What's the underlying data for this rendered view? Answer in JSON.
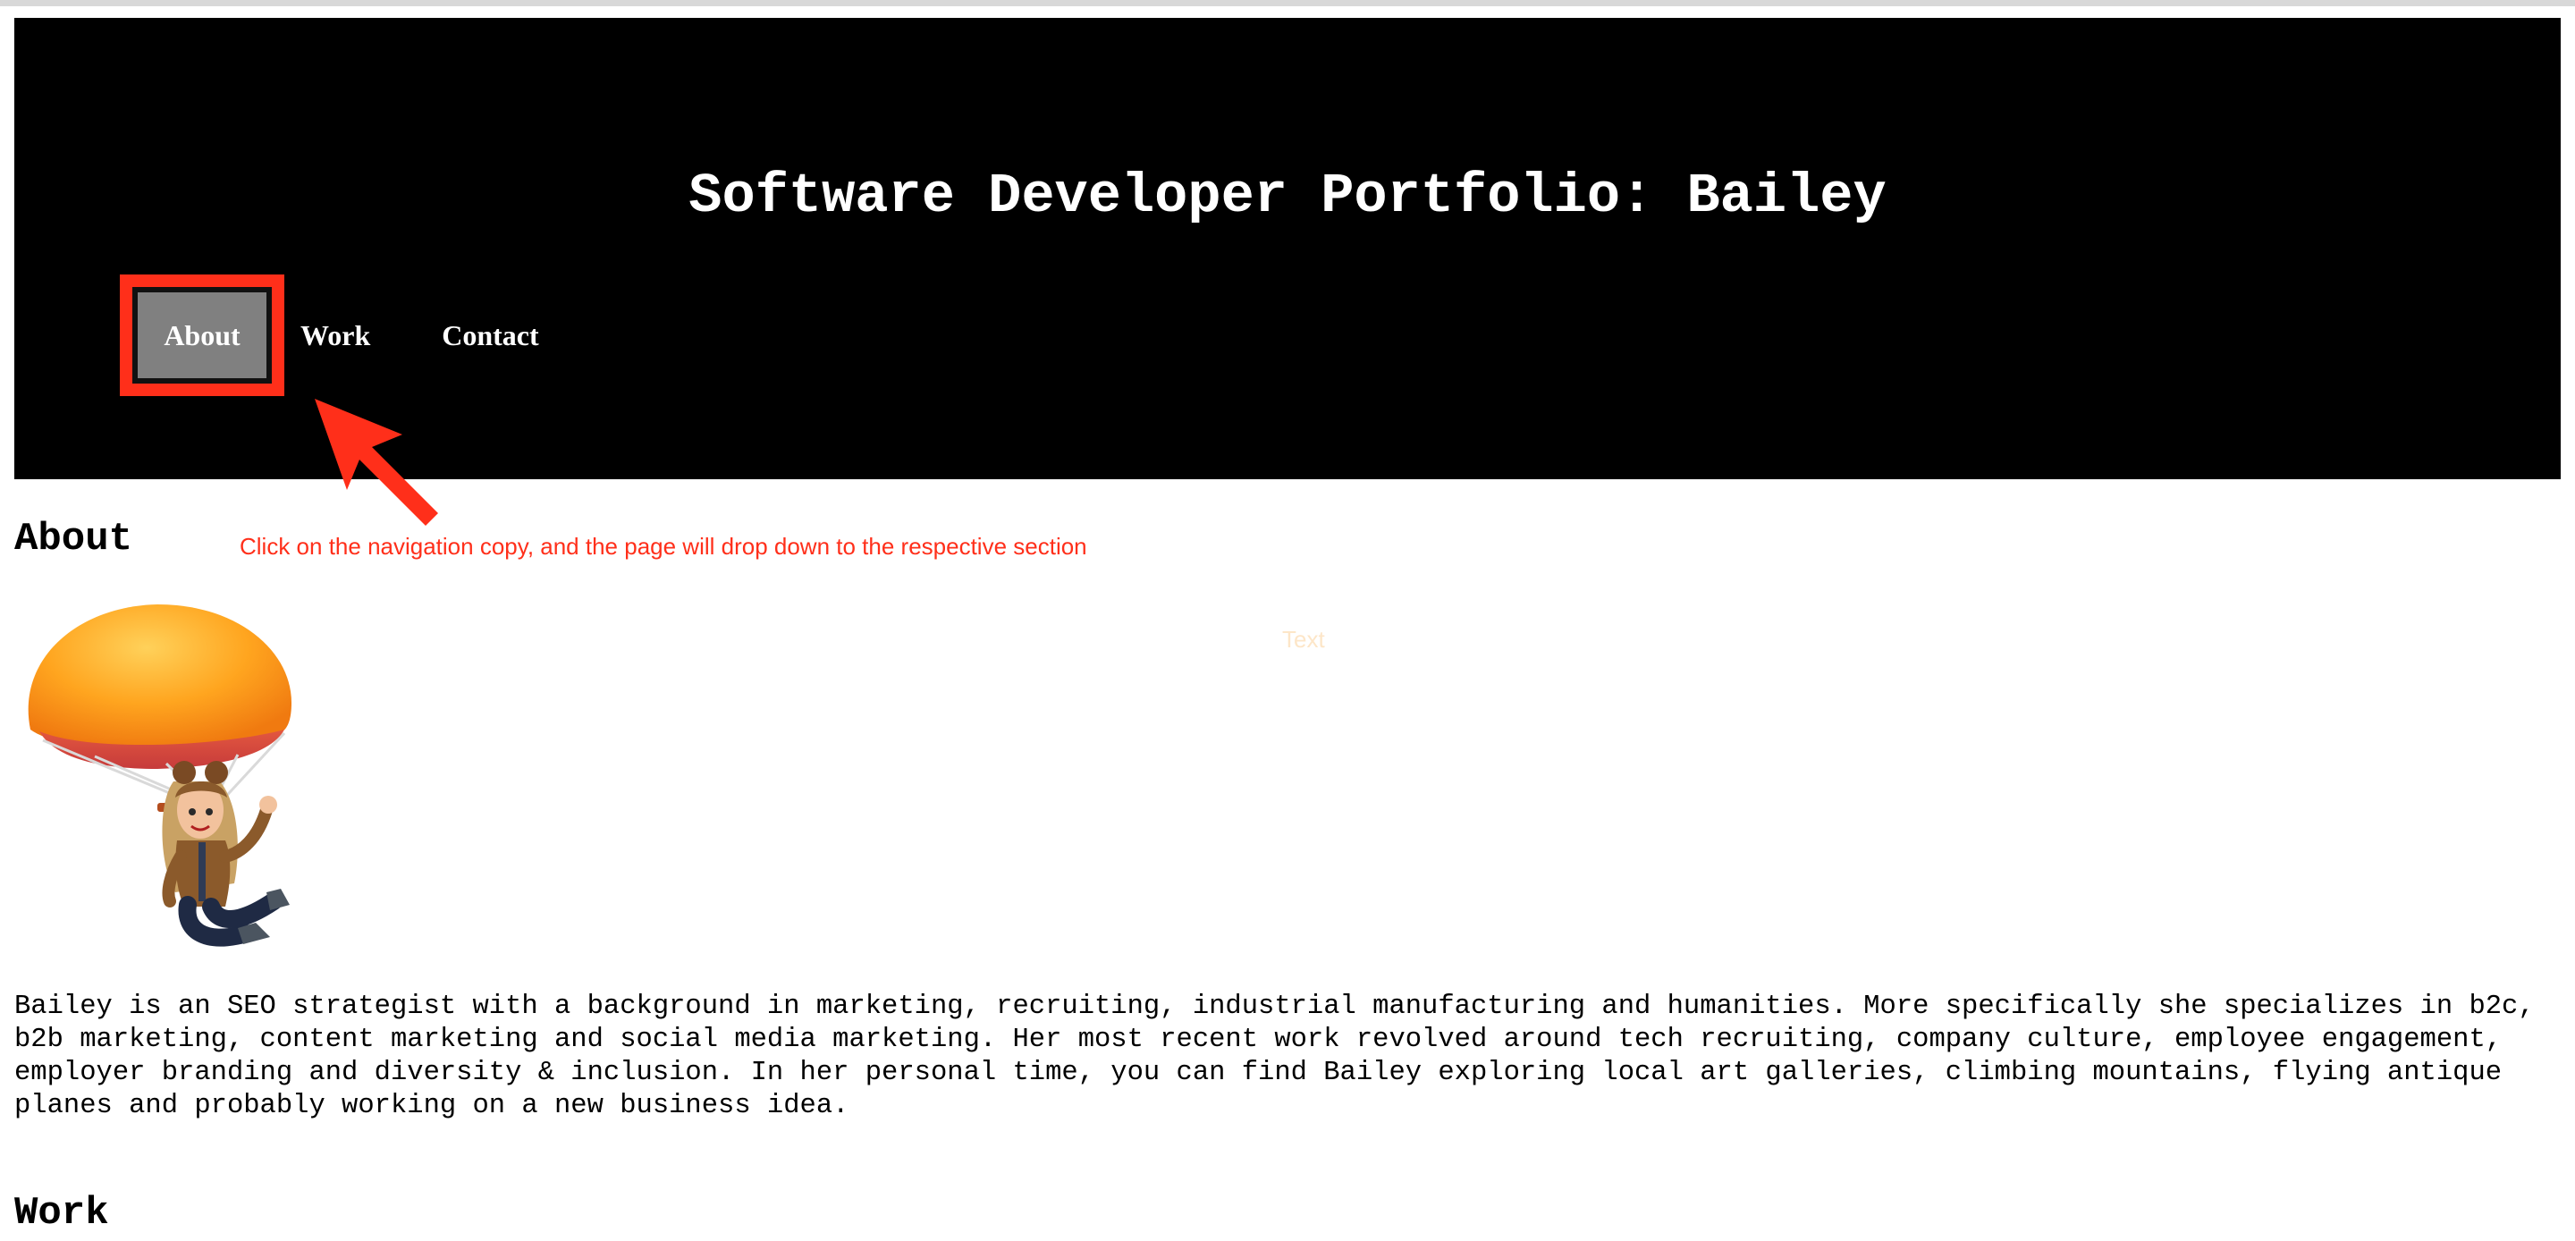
{
  "header": {
    "title": "Software Developer Portfolio: Bailey",
    "nav": [
      {
        "label": "About",
        "active": true
      },
      {
        "label": "Work"
      },
      {
        "label": "Contact"
      }
    ]
  },
  "annotation": {
    "text": "Click on the navigation copy, and the page will drop down to the respective section",
    "color": "#ff2f1a"
  },
  "ghost_text": "Text",
  "about": {
    "heading": "About",
    "avatar_icon": "parachute-avatar",
    "bio": "Bailey is an SEO strategist with a background in marketing, recruiting, industrial manufacturing and humanities. More specifically she specializes in b2c, b2b marketing, content marketing and social media marketing. Her most recent work revolved around tech recruiting, company culture, employee engagement, employer branding and diversity & inclusion. In her personal time, you can find Bailey exploring local art galleries, climbing mountains, flying antique planes and probably working on a new business idea."
  },
  "work": {
    "heading": "Work"
  },
  "colors": {
    "header_bg": "#000000",
    "active_nav_bg": "#808080",
    "highlight": "#ff2f1a"
  }
}
